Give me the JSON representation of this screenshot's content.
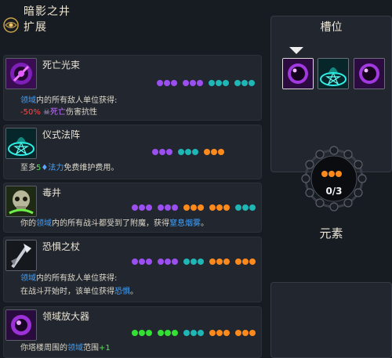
{
  "header": {
    "title": "暗影之井",
    "subtitle": "扩展"
  },
  "colors": {
    "purple": "#9b4ff0",
    "teal": "#1fb6b6",
    "orange": "#ff8a1c",
    "green": "#33e033",
    "blue_highlight": "#3fa3ff",
    "red_highlight": "#ff4848"
  },
  "cards": [
    {
      "name": "死亡光束",
      "icon": "death-beam-icon",
      "dots": [
        [
          "purple",
          "purple",
          "purple"
        ],
        [
          "purple",
          "purple",
          "purple"
        ],
        [
          "teal",
          "teal",
          "teal"
        ],
        [
          "teal",
          "teal",
          "teal"
        ]
      ],
      "line1": {
        "pre": "",
        "hl": "领域",
        "post": "内的所有敌人单位获得:"
      },
      "line2": {
        "pct": "-50%",
        "skull": "skull-icon",
        "dmg": "死亡",
        "post": "伤害抗性"
      }
    },
    {
      "name": "仪式法阵",
      "icon": "ritual-circle-icon",
      "dots": [
        [
          "purple",
          "purple",
          "purple"
        ],
        [
          "teal",
          "teal",
          "teal"
        ],
        [
          "orange",
          "orange",
          "orange"
        ]
      ],
      "line1": {
        "pre": "至多",
        "num": "5",
        "mana_icon": "mana-icon",
        "hl": "法力",
        "post": "免费维护费用。"
      }
    },
    {
      "name": "毒井",
      "icon": "poison-well-icon",
      "dots": [
        [
          "purple",
          "purple",
          "purple"
        ],
        [
          "purple",
          "purple",
          "purple"
        ],
        [
          "orange",
          "orange",
          "orange"
        ],
        [
          "orange",
          "orange",
          "orange"
        ],
        [
          "teal",
          "teal",
          "teal"
        ]
      ],
      "line1": {
        "pre": "你的",
        "hl": "领域",
        "post": "内的所有战斗都受到了附魔，获得",
        "hl2": "窒息烟雾",
        "end": "。"
      }
    },
    {
      "name": "恐惧之杖",
      "icon": "fear-staff-icon",
      "dots": [
        [
          "purple",
          "purple",
          "purple"
        ],
        [
          "purple",
          "purple",
          "purple"
        ],
        [
          "teal",
          "teal",
          "teal"
        ],
        [
          "orange",
          "orange",
          "orange"
        ],
        [
          "orange",
          "orange",
          "orange"
        ]
      ],
      "line1": {
        "pre": "",
        "hl": "领域",
        "post": "内的所有敌人单位获得:"
      },
      "line2": {
        "pre": "在战斗开始时，该单位获得",
        "hl": "恐惧",
        "end": "。"
      }
    },
    {
      "name": "领域放大器",
      "icon": "domain-amplifier-icon",
      "dots": [
        [
          "green",
          "green",
          "green"
        ],
        [
          "green",
          "green",
          "green"
        ],
        [
          "teal",
          "teal",
          "teal"
        ],
        [
          "orange",
          "orange",
          "orange"
        ],
        [
          "orange",
          "orange",
          "orange"
        ]
      ],
      "line1": {
        "pre": "你塔楼周围的",
        "hl": "领域",
        "post": "范围",
        "plus": "+1"
      }
    }
  ],
  "slots_panel": {
    "title": "槽位",
    "slots": [
      {
        "icon": "shadow-orb-icon",
        "selected": true
      },
      {
        "icon": "ritual-circle-icon",
        "selected": false
      },
      {
        "icon": "shadow-orb-icon",
        "selected": false
      }
    ]
  },
  "element_panel": {
    "count": "0/3",
    "label": "元素",
    "orbs": [
      "orange",
      "orange",
      "orange"
    ]
  }
}
